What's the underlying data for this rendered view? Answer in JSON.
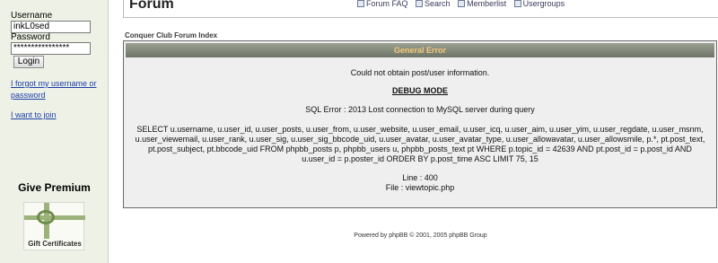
{
  "sidebar": {
    "username_label": "Username",
    "username_value": "inkL0sed",
    "password_label": "Password",
    "password_value": "****************",
    "login_label": "Login",
    "forgot_link": "I forgot my username or password",
    "join_link": "I want to join",
    "premium_heading": "Give Premium",
    "gift_text": "Gift Certificates"
  },
  "header": {
    "title": "Forum",
    "nav": [
      {
        "label": "Forum FAQ",
        "icon": "faq-icon"
      },
      {
        "label": "Search",
        "icon": "search-icon"
      },
      {
        "label": "Memberlist",
        "icon": "memberlist-icon"
      },
      {
        "label": "Usergroups",
        "icon": "usergroups-icon"
      }
    ]
  },
  "breadcrumb": "Conquer Club Forum Index",
  "error": {
    "title": "General Error",
    "message": "Could not obtain post/user information.",
    "debug_title": "DEBUG MODE",
    "sql_error": "SQL Error : 2013 Lost connection to MySQL server during query",
    "sql_query": "SELECT u.username, u.user_id, u.user_posts, u.user_from, u.user_website, u.user_email, u.user_icq, u.user_aim, u.user_yim, u.user_regdate, u.user_msnm, u.user_viewemail, u.user_rank, u.user_sig, u.user_sig_bbcode_uid, u.user_avatar, u.user_avatar_type, u.user_allowavatar, u.user_allowsmile, p.*, pt.post_text, pt.post_subject, pt.bbcode_uid FROM phpbb_posts p, phpbb_users u, phpbb_posts_text pt WHERE p.topic_id = 42639 AND pt.post_id = p.post_id AND u.user_id = p.poster_id ORDER BY p.post_time ASC LIMIT 75, 15",
    "line": "Line : 400",
    "file": "File : viewtopic.php"
  },
  "footer": {
    "prefix": "Powered by ",
    "link": "phpBB",
    "suffix": " © 2001, 2005 phpBB Group"
  }
}
